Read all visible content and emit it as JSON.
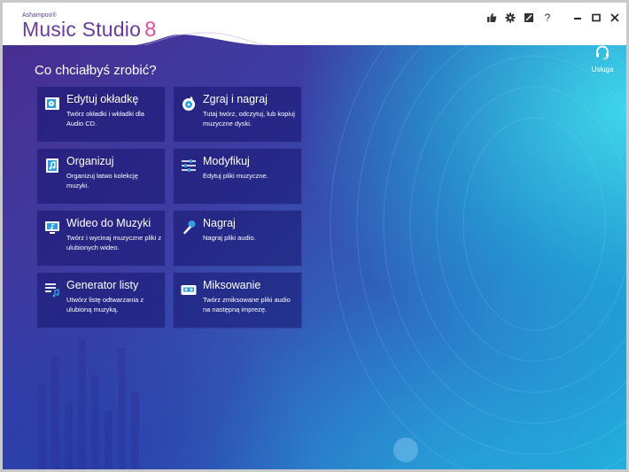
{
  "app": {
    "vendor": "Ashampoo®",
    "name": "Music Studio",
    "version": "8"
  },
  "window_controls": {
    "icons": [
      "thumbs-up-icon",
      "gear-icon",
      "skin-icon",
      "help-icon",
      "minimize-icon",
      "maximize-icon",
      "close-icon"
    ],
    "help_glyph": "?"
  },
  "service": {
    "label": "Usługa",
    "icon": "headset-icon"
  },
  "main": {
    "heading": "Co chciałbyś zrobić?",
    "tiles": [
      {
        "title": "Edytuj okładkę",
        "description": "Twórz okładki i wkładki dla Audio CD.",
        "icon": "cover-icon"
      },
      {
        "title": "Zgraj i nagraj",
        "description": "Tutaj twórz, odczytuj, lub kopiuj muzyczne dyski.",
        "icon": "disc-icon"
      },
      {
        "title": "Organizuj",
        "description": "Organizuj łatwo kolekcję muzyki.",
        "icon": "music-library-icon"
      },
      {
        "title": "Modyfikuj",
        "description": "Edytuj pliki muzyczne.",
        "icon": "sliders-icon"
      },
      {
        "title": "Wideo do Muzyki",
        "description": "Twórz i wycinaj muzyczne pliki z ulubionych wideo.",
        "icon": "monitor-music-icon"
      },
      {
        "title": "Nagraj",
        "description": "Nagraj pliki audio.",
        "icon": "microphone-icon"
      },
      {
        "title": "Generator listy",
        "description": "Utwórz listę odtwarzania z ulubioną muzyką.",
        "icon": "playlist-icon"
      },
      {
        "title": "Miksowanie",
        "description": "Twórz zmiksowane pliki audio na następną imprezę.",
        "icon": "cassette-icon"
      }
    ]
  },
  "colors": {
    "brand_purple": "#6a3a9d",
    "brand_pink": "#e04f9a",
    "tile_bg": "rgba(22,20,110,0.55)",
    "icon_blue": "#2f9fe0"
  }
}
